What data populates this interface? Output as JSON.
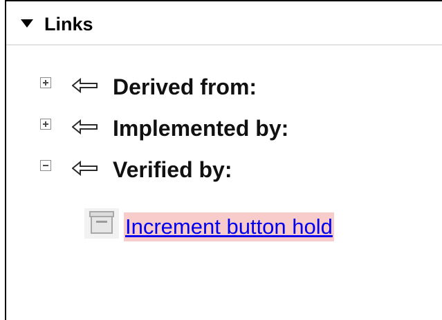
{
  "links_panel": {
    "title": "Links",
    "toggle_icon": "triangle-down-icon",
    "groups": [
      {
        "expander_icon": "plus-box-icon",
        "direction_icon": "left-arrow-icon",
        "label": "Derived from:",
        "expanded": false
      },
      {
        "expander_icon": "plus-box-icon",
        "direction_icon": "left-arrow-icon",
        "label": "Implemented by:",
        "expanded": false
      },
      {
        "expander_icon": "minus-box-icon",
        "direction_icon": "left-arrow-icon",
        "label": "Verified by:",
        "expanded": true
      }
    ],
    "verified_by_items": [
      {
        "icon": "test-case-icon",
        "label": "Increment button hold",
        "highlight_color": "#f9cccc",
        "link_color": "#0000ee"
      }
    ]
  }
}
